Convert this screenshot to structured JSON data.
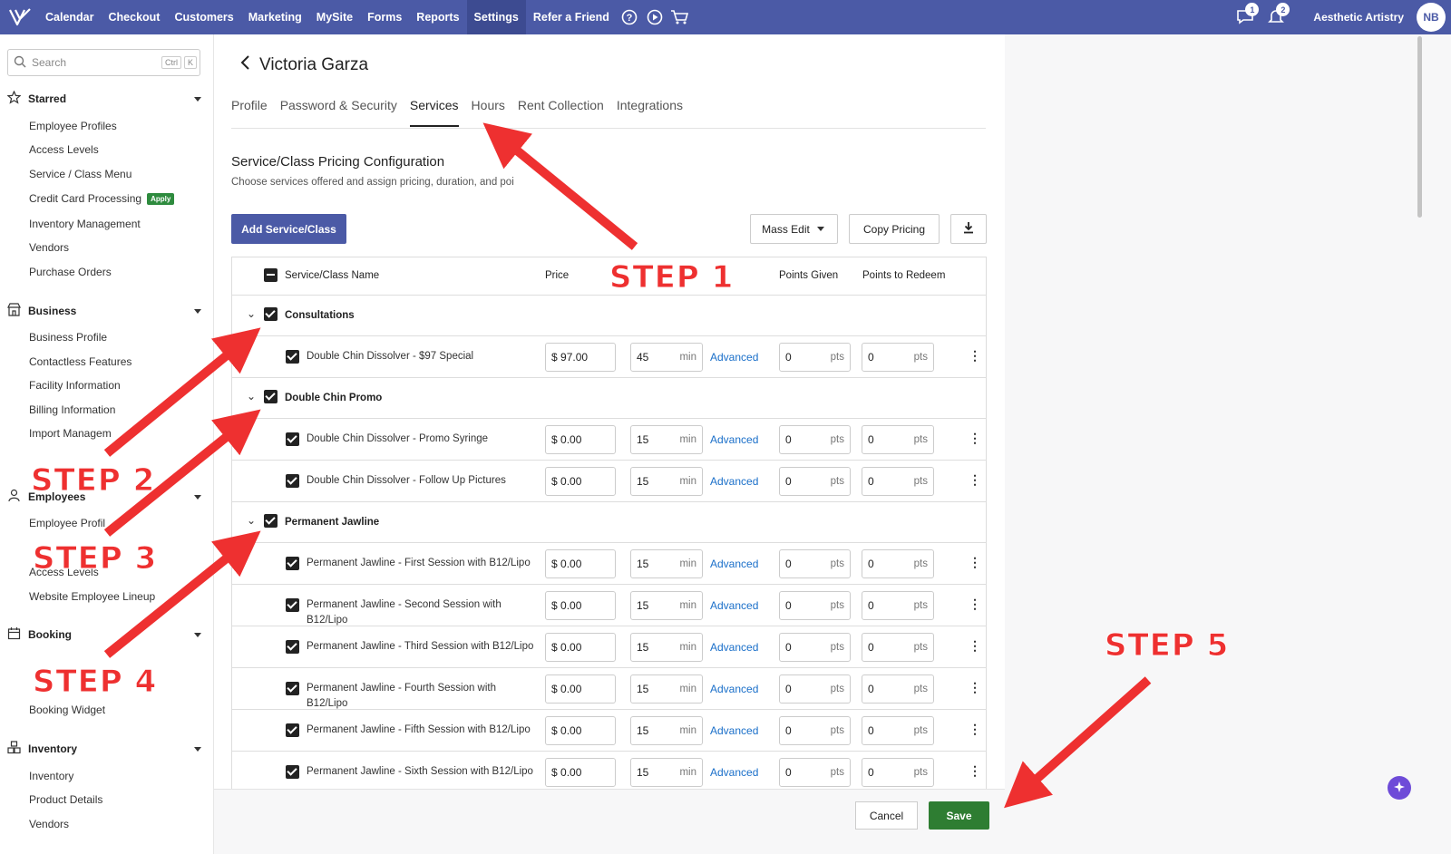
{
  "topbar": {
    "nav": [
      "Calendar",
      "Checkout",
      "Customers",
      "Marketing",
      "MySite",
      "Forms",
      "Reports",
      "Settings",
      "Refer a Friend"
    ],
    "active_nav": "Settings",
    "messages_badge": "1",
    "notifications_badge": "2",
    "business_name": "Aesthetic Artistry",
    "avatar_initials": "NB",
    "brand_color": "#4b5aa6"
  },
  "sidebar": {
    "search_placeholder": "Search",
    "shortcut_ctrl": "Ctrl",
    "shortcut_key": "K",
    "starred": {
      "label": "Starred",
      "items": [
        "Employee Profiles",
        "Access Levels",
        "Service / Class Menu",
        "Credit Card Processing",
        "Inventory Management",
        "Vendors",
        "Purchase Orders"
      ],
      "apply_badge": "Apply"
    },
    "business": {
      "label": "Business",
      "items": [
        "Business Profile",
        "Contactless Features",
        "Facility Information",
        "Billing Information",
        "Import Managem"
      ]
    },
    "employees": {
      "label": "Employees",
      "items": [
        "Employee Profil",
        "Access Levels",
        "Website Employee Lineup"
      ]
    },
    "booking": {
      "label": "Booking",
      "items": [
        "Booking Widget"
      ]
    },
    "inventory": {
      "label": "Inventory",
      "items": [
        "Inventory",
        "Product Details",
        "Vendors"
      ]
    }
  },
  "page": {
    "title": "Victoria Garza",
    "tabs": [
      "Profile",
      "Password & Security",
      "Services",
      "Hours",
      "Rent Collection",
      "Integrations"
    ],
    "active_tab": "Services",
    "section_title": "Service/Class Pricing Configuration",
    "section_subtitle": "Choose services offered and assign pricing, duration, and poi",
    "add_button": "Add Service/Class",
    "mass_edit": "Mass Edit",
    "copy_pricing": "Copy Pricing"
  },
  "table": {
    "headers": {
      "name": "Service/Class Name",
      "price": "Price",
      "points_given": "Points Given",
      "points_redeem": "Points to Redeem"
    },
    "advanced_label": "Advanced",
    "min_suffix": "min",
    "pts_suffix": "pts",
    "currency": "$",
    "groups": [
      {
        "name": "Consultations",
        "rows": [
          {
            "name": "Double Chin Dissolver - $97 Special",
            "price": "97.00",
            "duration": "45",
            "given": "0",
            "redeem": "0"
          }
        ]
      },
      {
        "name": "Double Chin Promo",
        "rows": [
          {
            "name": "Double Chin Dissolver - Promo Syringe",
            "price": "0.00",
            "duration": "15",
            "given": "0",
            "redeem": "0"
          },
          {
            "name": "Double Chin Dissolver - Follow Up Pictures",
            "price": "0.00",
            "duration": "15",
            "given": "0",
            "redeem": "0"
          }
        ]
      },
      {
        "name": "Permanent Jawline",
        "rows": [
          {
            "name": "Permanent Jawline - First Session with B12/Lipo",
            "price": "0.00",
            "duration": "15",
            "given": "0",
            "redeem": "0"
          },
          {
            "name": "Permanent Jawline - Second Session with B12/Lipo",
            "price": "0.00",
            "duration": "15",
            "given": "0",
            "redeem": "0"
          },
          {
            "name": "Permanent Jawline - Third Session with B12/Lipo",
            "price": "0.00",
            "duration": "15",
            "given": "0",
            "redeem": "0"
          },
          {
            "name": "Permanent Jawline - Fourth Session with B12/Lipo",
            "price": "0.00",
            "duration": "15",
            "given": "0",
            "redeem": "0"
          },
          {
            "name": "Permanent Jawline - Fifth Session with B12/Lipo",
            "price": "0.00",
            "duration": "15",
            "given": "0",
            "redeem": "0"
          },
          {
            "name": "Permanent Jawline - Sixth Session with B12/Lipo",
            "price": "0.00",
            "duration": "15",
            "given": "0",
            "redeem": "0"
          }
        ]
      }
    ]
  },
  "footer": {
    "cancel": "Cancel",
    "save": "Save"
  },
  "annotations": {
    "steps": [
      "STEP 1",
      "STEP 2",
      "STEP 3",
      "STEP 4",
      "STEP 5"
    ],
    "color": "#ee3030"
  }
}
